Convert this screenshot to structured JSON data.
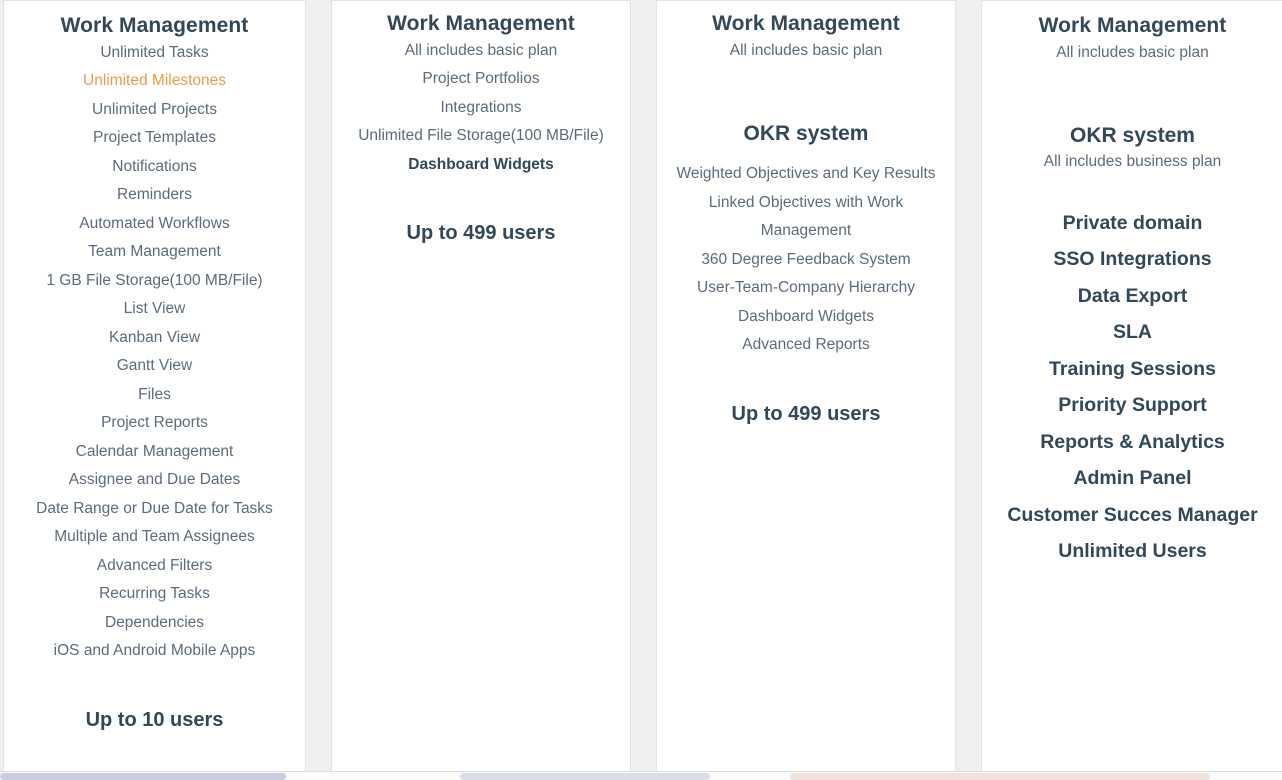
{
  "page": {
    "title": "Work Management Plan Comparison",
    "accent_highlight_color": "#f09a48",
    "heading_color": "#33475b",
    "body_text_color": "#5b6b7c",
    "card_background": "#ffffff",
    "page_background": "#f0f0f0"
  },
  "columns": [
    {
      "id": "basic",
      "heading": "Work Management",
      "features": [
        {
          "label": "Unlimited Tasks",
          "style": "normal"
        },
        {
          "label": "Unlimited Milestones",
          "style": "highlight"
        },
        {
          "label": "Unlimited Projects",
          "style": "normal"
        },
        {
          "label": "Project Templates",
          "style": "normal"
        },
        {
          "label": "Notifications",
          "style": "normal"
        },
        {
          "label": "Reminders",
          "style": "normal"
        },
        {
          "label": "Automated Workflows",
          "style": "normal"
        },
        {
          "label": "Team Management",
          "style": "normal"
        },
        {
          "label": "1 GB File Storage(100 MB/File)",
          "style": "normal"
        },
        {
          "label": "List View",
          "style": "normal"
        },
        {
          "label": "Kanban View",
          "style": "normal"
        },
        {
          "label": "Gantt View",
          "style": "normal"
        },
        {
          "label": "Files",
          "style": "normal"
        },
        {
          "label": "Project Reports",
          "style": "normal"
        },
        {
          "label": "Calendar Management",
          "style": "normal"
        },
        {
          "label": "Assignee and Due Dates",
          "style": "normal"
        },
        {
          "label": "Date Range or Due Date for Tasks",
          "style": "normal"
        },
        {
          "label": "Multiple and Team Assignees",
          "style": "normal"
        },
        {
          "label": "Advanced Filters",
          "style": "normal"
        },
        {
          "label": "Recurring Tasks",
          "style": "normal"
        },
        {
          "label": "Dependencies",
          "style": "normal"
        },
        {
          "label": "iOS and Android Mobile Apps",
          "style": "normal"
        }
      ],
      "users": "Up to 10 users"
    },
    {
      "id": "business",
      "heading": "Work Management",
      "features": [
        {
          "label": "All includes basic plan",
          "style": "normal"
        },
        {
          "label": "Project Portfolios",
          "style": "normal"
        },
        {
          "label": "Integrations",
          "style": "normal"
        },
        {
          "label": "Unlimited File Storage(100 MB/File)",
          "style": "normal"
        },
        {
          "label": "Dashboard Widgets",
          "style": "strong"
        }
      ],
      "users": "Up to 499 users"
    },
    {
      "id": "okr",
      "heading": "Work Management",
      "features": [
        {
          "label": "All includes basic plan",
          "style": "normal"
        }
      ],
      "okr_heading": "OKR system",
      "okr_features": [
        {
          "label": "Weighted Objectives and Key Results",
          "style": "normal"
        },
        {
          "label": "Linked Objectives with Work Management",
          "style": "normal"
        },
        {
          "label": "360 Degree Feedback System",
          "style": "normal"
        },
        {
          "label": "User-Team-Company Hierarchy",
          "style": "normal"
        },
        {
          "label": "Dashboard Widgets",
          "style": "normal"
        },
        {
          "label": "Advanced Reports",
          "style": "normal"
        }
      ],
      "users": "Up to 499 users"
    },
    {
      "id": "enterprise",
      "heading": "Work Management",
      "features": [
        {
          "label": "All includes basic plan",
          "style": "normal"
        }
      ],
      "okr_heading": "OKR system",
      "okr_subtitle": "All includes business plan",
      "enterprise_features": [
        {
          "label": "Private domain",
          "style": "big"
        },
        {
          "label": "SSO Integrations",
          "style": "big"
        },
        {
          "label": "Data Export",
          "style": "big"
        },
        {
          "label": "SLA",
          "style": "big"
        },
        {
          "label": "Training Sessions",
          "style": "big"
        },
        {
          "label": "Priority Support",
          "style": "big"
        },
        {
          "label": "Reports & Analytics",
          "style": "big"
        },
        {
          "label": "Admin Panel",
          "style": "big"
        },
        {
          "label": "Customer Succes Manager",
          "style": "big"
        },
        {
          "label": "Unlimited Users",
          "style": "big"
        }
      ]
    }
  ],
  "scrollbar": {
    "orientation": "horizontal",
    "position": "bottom"
  }
}
